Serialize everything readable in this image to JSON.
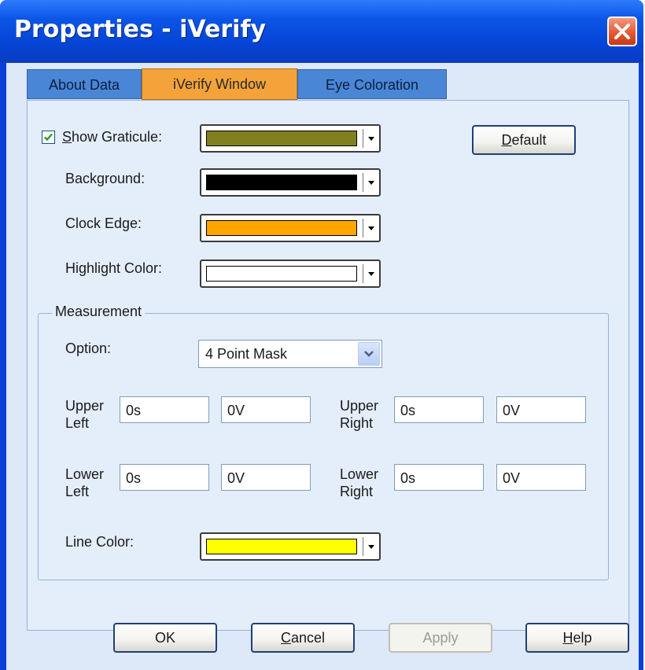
{
  "window": {
    "title": "Properties - iVerify"
  },
  "tabs": [
    {
      "label": "About Data",
      "active": false
    },
    {
      "label": "iVerify Window",
      "active": true
    },
    {
      "label": "Eye Coloration",
      "active": false
    }
  ],
  "display": {
    "show_graticule": {
      "mnemonic": "S",
      "label_rest": "how Graticule:",
      "checked": true,
      "color": "#808020"
    },
    "background": {
      "label": "Background:",
      "color": "#000000"
    },
    "clock_edge": {
      "label": "Clock Edge:",
      "color": "#ffa500"
    },
    "highlight_color": {
      "label": "Highlight Color:",
      "color": "#ffffff"
    },
    "default_button": {
      "mnemonic": "D",
      "label_rest": "efault"
    }
  },
  "measurement": {
    "group_label": "Measurement",
    "option": {
      "label": "Option:",
      "value": "4 Point Mask"
    },
    "upper_left": {
      "label_line1": "Upper",
      "label_line2": "Left",
      "time": "0s",
      "voltage": "0V"
    },
    "upper_right": {
      "label_line1": "Upper",
      "label_line2": "Right",
      "time": "0s",
      "voltage": "0V"
    },
    "lower_left": {
      "label_line1": "Lower",
      "label_line2": "Left",
      "time": "0s",
      "voltage": "0V"
    },
    "lower_right": {
      "label_line1": "Lower",
      "label_line2": "Right",
      "time": "0s",
      "voltage": "0V"
    },
    "line_color": {
      "label": "Line Color:",
      "color": "#ffff00"
    }
  },
  "footer": {
    "ok": "OK",
    "cancel": {
      "mnemonic": "C",
      "label_rest": "ancel"
    },
    "apply": "Apply",
    "help": {
      "mnemonic": "H",
      "label_rest": "elp"
    }
  },
  "icons": {
    "close": "close-icon",
    "check": "checkmark-icon",
    "dropdown": "chevron-down-icon"
  }
}
